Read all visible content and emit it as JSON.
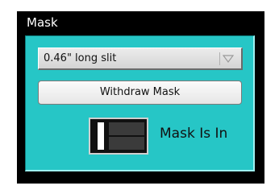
{
  "group": {
    "title": "Mask"
  },
  "mask_select": {
    "value": "0.46\" long slit",
    "arrow_icon": "chevron-down-icon"
  },
  "withdraw_button": {
    "label": "Withdraw Mask"
  },
  "mask_switch": {
    "state": "in"
  },
  "status": {
    "text": "Mask Is In"
  },
  "colors": {
    "panel": "#26c6c6",
    "frame": "#000000"
  }
}
